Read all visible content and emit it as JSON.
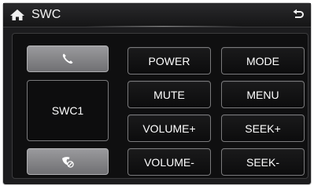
{
  "header": {
    "title": "SWC",
    "home_icon": "home-icon",
    "back_icon": "back-icon"
  },
  "left_column": {
    "call_icon": "phone-icon",
    "slot_label": "SWC1",
    "hangup_icon": "hang-up-icon"
  },
  "buttons": {
    "power": "POWER",
    "mode": "MODE",
    "mute": "MUTE",
    "menu": "MENU",
    "volume_up": "VOLUME+",
    "seek_up": "SEEK+",
    "volume_down": "VOLUME-",
    "seek_down": "SEEK-"
  },
  "colors": {
    "background": "#1c1c1e",
    "highlight_button": "#8a8a8d",
    "button_border": "#7a7a7c",
    "text": "#ffffff"
  }
}
